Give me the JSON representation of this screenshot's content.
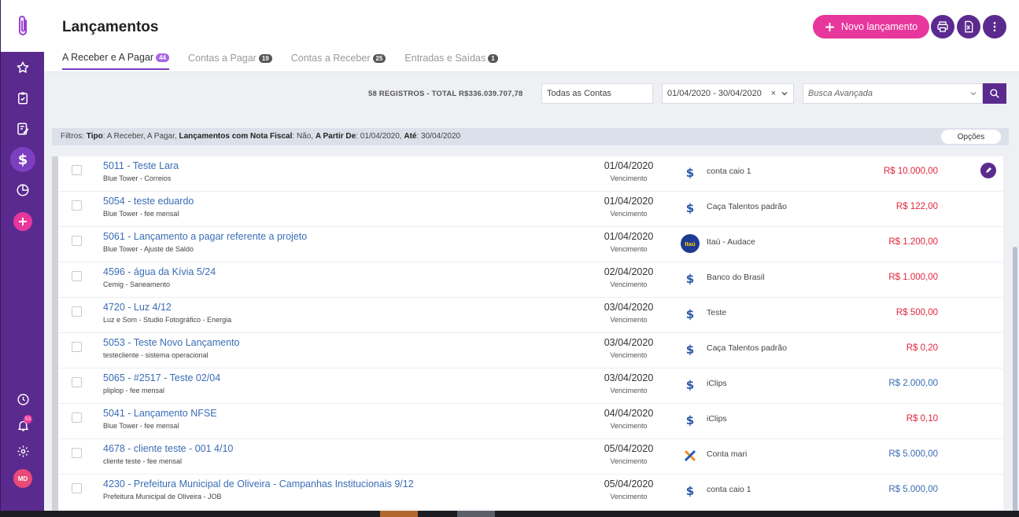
{
  "sidebar": {
    "avatar_initials": "MD",
    "notification_count": "53",
    "accent": "#5b2a8e"
  },
  "header": {
    "title": "Lançamentos",
    "new_button_label": "Novo lançamento",
    "tabs": [
      {
        "label": "A Receber e A Pagar",
        "count": "44"
      },
      {
        "label": "Contas a Pagar",
        "count": "19"
      },
      {
        "label": "Contas a Receber",
        "count": "25"
      },
      {
        "label": "Entradas e Saídas",
        "count": "1"
      }
    ]
  },
  "toolbar": {
    "summary": "58 REGISTROS - TOTAL R$336.039.707,78",
    "account_filter": "Todas as Contas",
    "date_range": "01/04/2020 - 30/04/2020",
    "search_placeholder": "Busca Avançada"
  },
  "filters": {
    "prefix": "Filtros:",
    "tipo_label": "Tipo",
    "tipo_value": ": A Receber, A Pagar,",
    "nf_label": "Lançamentos com Nota Fiscal",
    "nf_value": ": Não,",
    "from_label": "A Partir De",
    "from_value": ": 01/04/2020,",
    "to_label": "Até",
    "to_value": ": 30/04/2020",
    "options_label": "Opções"
  },
  "rows": [
    {
      "title": "5011 - Teste Lara",
      "sub": "Blue Tower - Correios",
      "date": "01/04/2020",
      "due": "Vencimento",
      "icon": "dollar-icon",
      "account": "conta caio 1",
      "amount": "R$ 10.000,00",
      "color": "#e0263e"
    },
    {
      "title": "5054 - teste eduardo",
      "sub": "Blue Tower - fee mensal",
      "date": "01/04/2020",
      "due": "Vencimento",
      "icon": "dollar-icon",
      "account": "Caça Talentos padrão",
      "amount": "R$ 122,00",
      "color": "#e0263e"
    },
    {
      "title": "5061 - Lançamento a pagar referente a projeto",
      "sub": "Blue Tower - Ajuste de Saldo",
      "date": "01/04/2020",
      "due": "Vencimento",
      "icon": "itau-logo",
      "icon_text": "Itaú",
      "account": "Itaú - Audace",
      "amount": "R$ 1.200,00",
      "color": "#e0263e"
    },
    {
      "title": "4596 - água da Kívia 5/24",
      "sub": "Cemig - Saneamento",
      "date": "02/04/2020",
      "due": "Vencimento",
      "icon": "dollar-icon",
      "account": "Banco do Brasil",
      "amount": "R$ 1.000,00",
      "color": "#e0263e"
    },
    {
      "title": "4720 - Luz 4/12",
      "sub": "Luz e Som - Studio Fotográfico - Energia",
      "date": "03/04/2020",
      "due": "Vencimento",
      "icon": "dollar-icon",
      "account": "Teste",
      "amount": "R$ 500,00",
      "color": "#e0263e"
    },
    {
      "title": "5053 - Teste Novo Lançamento",
      "sub": "testecliente - sistema operacional",
      "date": "03/04/2020",
      "due": "Vencimento",
      "icon": "dollar-icon",
      "account": "Caça Talentos padrão",
      "amount": "R$ 0,20",
      "color": "#e0263e"
    },
    {
      "title": "5065 - #2517 - Teste 02/04",
      "sub": "pliplop - fee mensal",
      "date": "03/04/2020",
      "due": "Vencimento",
      "icon": "dollar-icon",
      "account": "iClips",
      "amount": "R$ 2.000,00",
      "color": "#3a6db5"
    },
    {
      "title": "5041 - Lançamento NFSE",
      "sub": "Blue Tower - fee mensal",
      "date": "04/04/2020",
      "due": "Vencimento",
      "icon": "dollar-icon",
      "account": "iClips",
      "amount": "R$ 0,10",
      "color": "#e0263e"
    },
    {
      "title": "4678 - cliente teste - 001 4/10",
      "sub": "cliente teste - fee mensal",
      "date": "05/04/2020",
      "due": "Vencimento",
      "icon": "caixa-x-icon",
      "account": "Conta mari",
      "amount": "R$ 5.000,00",
      "color": "#3a6db5"
    },
    {
      "title": "4230 - Prefeitura Municipal de Oliveira - Campanhas Institucionais 9/12",
      "sub": "Prefeitura Municipal de Oliveira - JOB",
      "date": "05/04/2020",
      "due": "Vencimento",
      "icon": "dollar-icon",
      "account": "conta caio 1",
      "amount": "R$ 5.000,00",
      "color": "#3a6db5"
    }
  ]
}
